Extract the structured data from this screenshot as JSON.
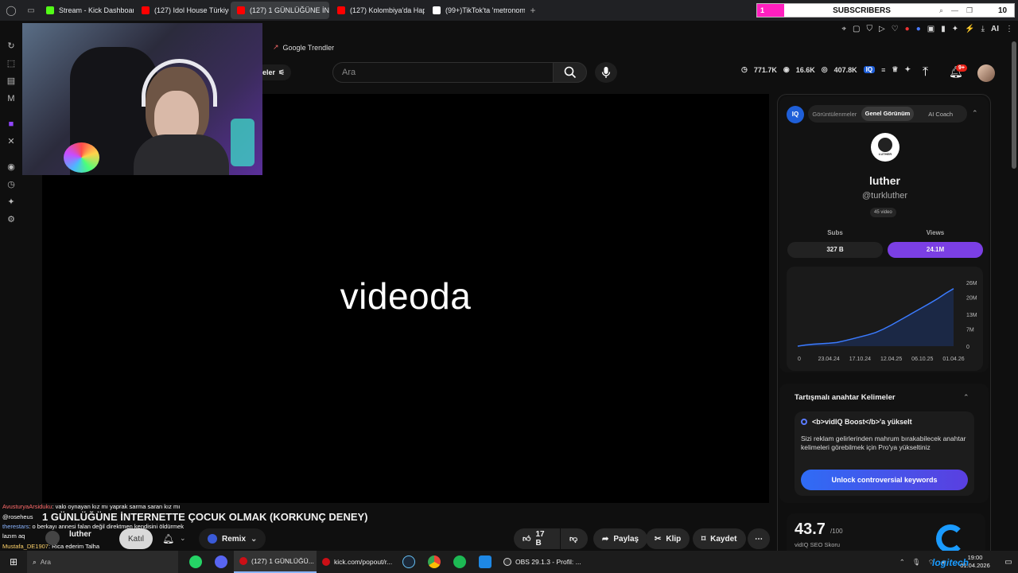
{
  "browser": {
    "tabs": [
      {
        "label": "Stream - Kick Dashboard",
        "color": "#53fc18"
      },
      {
        "label": "(127) Idol House Türkiye -",
        "color": "#ff0000"
      },
      {
        "label": "(127) 1 GÜNLÜĞÜNE İNTE",
        "color": "#ff0000",
        "active": true
      },
      {
        "label": "(127) Kolombiya'da Hapish",
        "color": "#ff0000"
      },
      {
        "label": "(99+)TikTok'ta 'metronom",
        "color": "#ffffff"
      }
    ],
    "new_tab": "+",
    "bookmark": "Google Trendler",
    "ai_label": "AI"
  },
  "subscribers": {
    "left_count": "1",
    "label": "SUBSCRIBERS",
    "right_count": "10"
  },
  "header": {
    "filters_label": "eler",
    "search_placeholder": "Ara",
    "stats": [
      "771.7K",
      "16.6K",
      "407.8K"
    ],
    "notif_badge": "9+"
  },
  "video": {
    "overlay_text": "videoda",
    "title": "1 GÜNLÜĞÜNE İNTERNETTE ÇOCUK OLMAK (KORKUNÇ DENEY)",
    "channel": "luther",
    "join_label": "Katıl",
    "remix_label": "Remix",
    "likes": "17 B",
    "share_label": "Paylaş",
    "clip_label": "Klip",
    "save_label": "Kaydet"
  },
  "chat": [
    {
      "user": "AvusturyaArsiduku",
      "msg": ": valo oynayan kız mı yaprak sarma saran kız mı",
      "color": "#ff6b6b"
    },
    {
      "user": "@roseheus",
      "msg": "",
      "color": "#ffffff"
    },
    {
      "user": "therestars",
      "msg": ": o berkayı annesi falan değil direktmen kendisini öldürmek",
      "color": "#8ab4ff"
    },
    {
      "user": "lazım aq",
      "msg": "",
      "color": "#ffffff"
    },
    {
      "user": "Mustafa_DE1907",
      "msg": ": Rica ederim Talha",
      "color": "#ffd36b"
    }
  ],
  "vidiq": {
    "logo": "IQ",
    "tabs": [
      "Görüntülenmeler",
      "Genel Görünüm",
      "AI Coach"
    ],
    "channel_name": "luther",
    "handle": "@turkluther",
    "video_count": "45 video",
    "avatar_caption": "LUTHER",
    "subs_label": "Subs",
    "views_label": "Views",
    "subs_value": "327 B",
    "views_value": "24.1M",
    "accent": "#7b3fe4",
    "keywords_title": "Tartışmalı anahtar Kelimeler",
    "boost_title": "<b>vidIQ Boost</b>'a yükselt",
    "boost_body": "Sizi reklam gelirlerinden mahrum bırakabilecek anahtar kelimeleri görebilmek için Pro'ya yükseltiniz",
    "unlock_label": "Unlock controversial keywords",
    "seo_score": "43.7",
    "seo_max": "/100",
    "seo_label": "vidIQ SEO Skoru"
  },
  "chart_data": {
    "type": "area",
    "x_ticks": [
      "0",
      "23.04.24",
      "17.10.24",
      "12.04.25",
      "06.10.25",
      "01.04.26"
    ],
    "y_ticks": [
      "0",
      "7M",
      "13M",
      "20M",
      "26M"
    ],
    "ylim": [
      0,
      26
    ],
    "x": [
      0,
      5,
      10,
      15,
      20,
      25,
      30,
      35,
      40,
      45,
      50,
      55,
      60,
      65,
      70,
      75,
      80,
      85,
      90,
      95,
      100
    ],
    "values": [
      0,
      0.5,
      0.8,
      1.0,
      1.2,
      1.5,
      2.2,
      3.0,
      3.8,
      4.6,
      5.6,
      7.0,
      8.6,
      10.4,
      12.2,
      14.0,
      15.8,
      17.6,
      19.5,
      21.6,
      23.5
    ]
  },
  "taskbar": {
    "search_placeholder": "Ara",
    "items": [
      "(127) 1 GÜNLÜĞÜ...",
      "kick.com/popout/r...",
      "OBS 29.1.3 - Profil: ..."
    ],
    "time": "19:00",
    "date": "01.04.2026",
    "watermark": "logitech"
  }
}
